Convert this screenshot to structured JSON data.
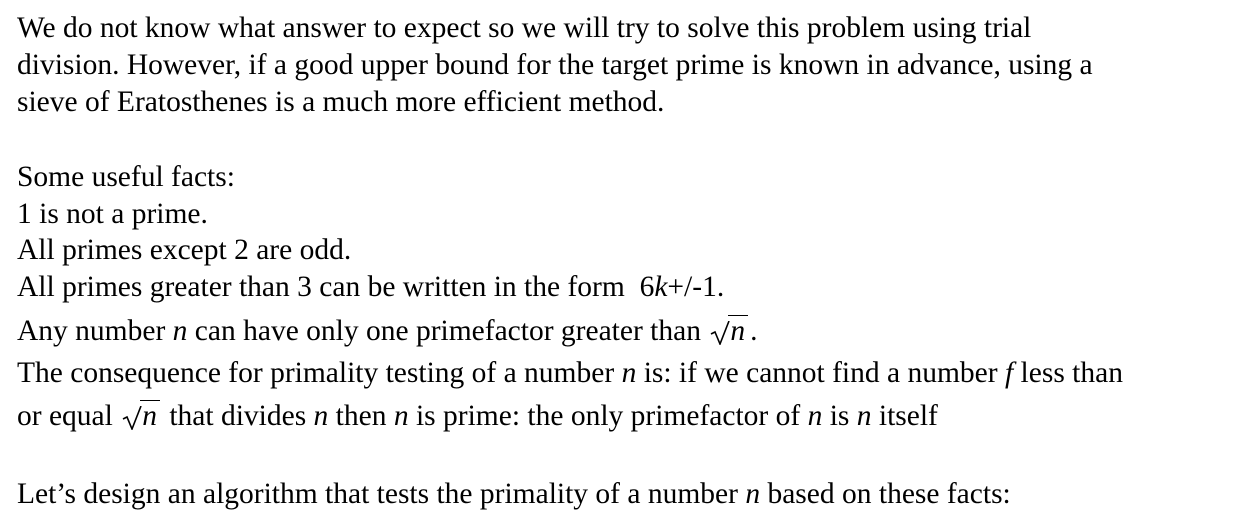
{
  "paragraph1": {
    "line1": "We do not know what answer to expect so we will try to solve this problem using trial",
    "line2": "division. However, if a good upper bound for the target prime is known in advance, using a",
    "line3": "sieve of Eratosthenes is a much more efficient method."
  },
  "facts": {
    "heading": "Some useful facts:",
    "fact1": "1 is not a prime.",
    "fact2": "All primes except 2 are odd.",
    "fact3_text": "All primes greater than 3 can be written in the form",
    "fact3_formula_a": "6",
    "fact3_formula_k": "k",
    "fact3_formula_b": "+/-1.",
    "fact4_a": "Any number",
    "fact4_n": "n",
    "fact4_b": "can have only one primefactor greater than",
    "fact4_sqrt_n": "n",
    "fact4_end": ".",
    "fact5_a": "The consequence for primality testing of a number",
    "fact5_n": "n",
    "fact5_b": "is: if we cannot find a number",
    "fact5_f": "f",
    "fact5_c": "less than",
    "fact6_a": "or equal",
    "fact6_sqrt_n": "n",
    "fact6_b": "that divides",
    "fact6_n1": "n",
    "fact6_c": "then",
    "fact6_n2": "n",
    "fact6_d": "is prime: the only primefactor of",
    "fact6_n3": "n",
    "fact6_e": "is",
    "fact6_n4": "n",
    "fact6_f": "itself"
  },
  "closing": {
    "text_a": "Let’s design an algorithm that tests the primality of a number",
    "text_n": "n",
    "text_b": "based on these facts:"
  }
}
